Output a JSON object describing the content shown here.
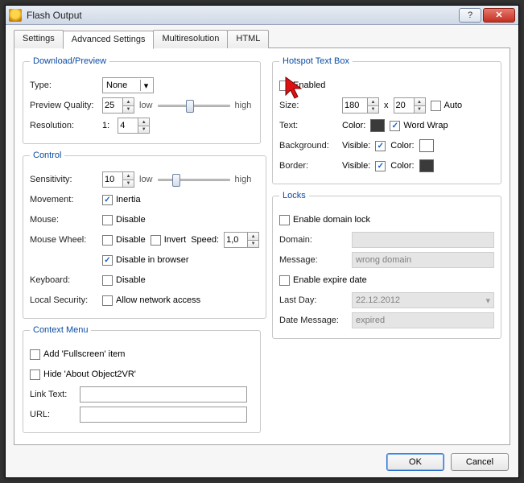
{
  "window": {
    "title": "Flash Output"
  },
  "tabs": [
    "Settings",
    "Advanced Settings",
    "Multiresolution",
    "HTML"
  ],
  "activeTab": 1,
  "download": {
    "legend": "Download/Preview",
    "type_label": "Type:",
    "type_value": "None",
    "preview_quality_label": "Preview Quality:",
    "preview_quality_value": "25",
    "low": "low",
    "high": "high",
    "resolution_label": "Resolution:",
    "resolution_prefix": "1:",
    "resolution_value": "4"
  },
  "control": {
    "legend": "Control",
    "sensitivity_label": "Sensitivity:",
    "sensitivity_value": "10",
    "low": "low",
    "high": "high",
    "movement_label": "Movement:",
    "inertia": "Inertia",
    "mouse_label": "Mouse:",
    "disable": "Disable",
    "mousewheel_label": "Mouse Wheel:",
    "invert": "Invert",
    "speed_label": "Speed:",
    "speed_value": "1,0",
    "disable_browser": "Disable in browser",
    "keyboard_label": "Keyboard:",
    "localsec_label": "Local Security:",
    "allow_network": "Allow network access"
  },
  "contextmenu": {
    "legend": "Context Menu",
    "add_fullscreen": "Add 'Fullscreen' item",
    "hide_about": "Hide 'About Object2VR'",
    "link_text_label": "Link Text:",
    "url_label": "URL:"
  },
  "hotspot": {
    "legend": "Hotspot Text Box",
    "enabled": "Enabled",
    "size_label": "Size:",
    "size_w": "180",
    "size_h": "20",
    "x": "x",
    "auto": "Auto",
    "text_label": "Text:",
    "color_label": "Color:",
    "wordwrap": "Word Wrap",
    "background_label": "Background:",
    "visible": "Visible:",
    "border_label": "Border:",
    "text_color": "#3a3a3a",
    "bg_color": "#ffffff",
    "border_color": "#3a3a3a"
  },
  "locks": {
    "legend": "Locks",
    "enable_domain": "Enable domain lock",
    "domain_label": "Domain:",
    "message_label": "Message:",
    "message_value": "wrong domain",
    "enable_expire": "Enable expire date",
    "lastday_label": "Last Day:",
    "lastday_value": "22.12.2012",
    "datemsg_label": "Date Message:",
    "datemsg_value": "expired"
  },
  "buttons": {
    "ok": "OK",
    "cancel": "Cancel"
  },
  "winbtns": {
    "help": "?",
    "close": "✕"
  }
}
